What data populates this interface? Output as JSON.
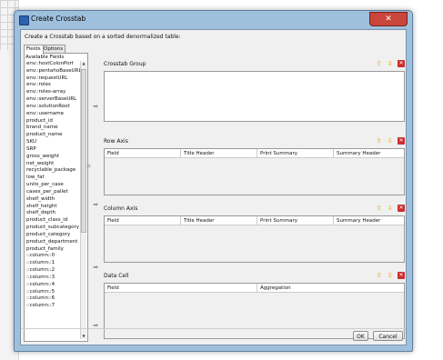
{
  "dialog": {
    "title": "Create Crosstab",
    "close_glyph": "✕",
    "instruction": "Create a Crosstab based on a sorted denormalized table:"
  },
  "left": {
    "tabs": [
      "Fields",
      "Options"
    ],
    "available_label": "Available Fields",
    "fields": [
      "env::hostColonPort",
      "env::pentahoBaseURL",
      "env::requestURL",
      "env::roles",
      "env::roles-array",
      "env::serverBaseURL",
      "env::solutionRoot",
      "env::username",
      "product_id",
      "brand_name",
      "product_name",
      "SKU",
      "SRP",
      "gross_weight",
      "net_weight",
      "recyclable_package",
      "low_fat",
      "units_per_case",
      "cases_per_pallet",
      "shelf_width",
      "shelf_height",
      "shelf_depth",
      "product_class_id",
      "product_subcategory",
      "product_category",
      "product_department",
      "product_family",
      "::column::0",
      "::column::1",
      "::column::2",
      "::column::3",
      "::column::4",
      "::column::5",
      "::column::6",
      "::column::7"
    ]
  },
  "sections": {
    "crosstab_group": {
      "title": "Crosstab Group"
    },
    "row_axis": {
      "title": "Row Axis",
      "columns": [
        "Field",
        "Title Header",
        "Print Summary",
        "Summary Header"
      ]
    },
    "column_axis": {
      "title": "Column Axis",
      "columns": [
        "Field",
        "Title Header",
        "Print Summary",
        "Summary Header"
      ]
    },
    "data_cell": {
      "title": "Data Cell",
      "columns": [
        "Field",
        "Aggregation"
      ]
    }
  },
  "icons": {
    "move_up": "arrow-up-icon",
    "move_down": "arrow-down-icon",
    "remove": "remove-icon",
    "add_to_section": "arrow-right-icon"
  },
  "buttons": {
    "ok": "OK",
    "cancel": "Cancel"
  },
  "colors": {
    "title_bar": "#9fc0dd",
    "close_button": "#c9463d",
    "arrow_icon": "#e8a000",
    "remove_icon": "#cc2d2d"
  }
}
